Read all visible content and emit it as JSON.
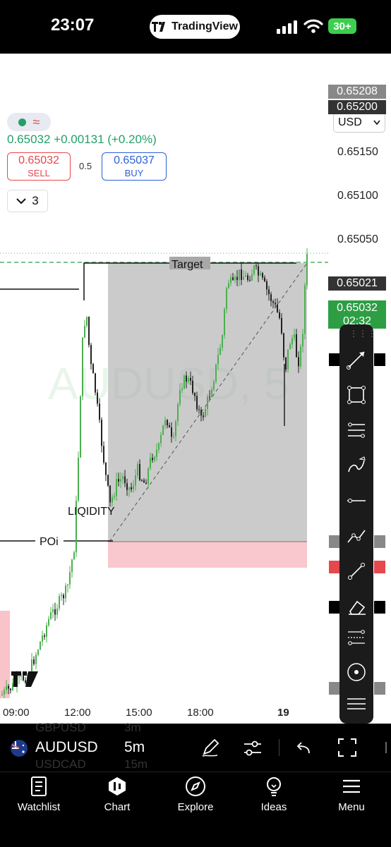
{
  "status_bar": {
    "time": "23:07",
    "app_pill": "TradingView",
    "battery": "30+"
  },
  "header": {
    "price_line": "0.65032 +0.00131 (+0.20%)",
    "sell": {
      "price": "0.65032",
      "label": "SELL"
    },
    "buy": {
      "price": "0.65037",
      "label": "BUY"
    },
    "spread": "0.5",
    "indicator_count": "3",
    "currency": "USD"
  },
  "chart": {
    "watermark": "AUDUSD, 5",
    "annotations": {
      "target": "Target",
      "liquidity": "LIQIDITY",
      "poi": "POi"
    },
    "price_labels": [
      "0.65150",
      "0.65100",
      "0.65050"
    ],
    "price_tags": {
      "top1": "0.65208",
      "top2": "0.65200",
      "current": "0.65032",
      "countdown": "02:32",
      "entry": "0.65021"
    },
    "time_labels": [
      "09:00",
      "12:00",
      "15:00",
      "18:00",
      "19"
    ],
    "bull_color": "#4caf50",
    "bear_color": "#222222"
  },
  "symbol_bar": {
    "symbol": "AUDUSD",
    "interval": "5m",
    "behind_symbols": [
      "GBPUSD",
      "USDCAD"
    ],
    "behind_intervals": [
      "3m",
      "15m"
    ]
  },
  "toolbar_icons": [
    "trend-line-icon",
    "rectangle-icon",
    "fib-retracement-icon",
    "brush-icon",
    "horizontal-line-icon",
    "path-icon",
    "ray-icon",
    "eraser-icon",
    "gann-icon",
    "circle-target-icon",
    "parallel-channel-icon"
  ],
  "nav": [
    {
      "label": "Watchlist",
      "icon": "watchlist-icon"
    },
    {
      "label": "Chart",
      "icon": "chart-icon"
    },
    {
      "label": "Explore",
      "icon": "compass-icon"
    },
    {
      "label": "Ideas",
      "icon": "lightbulb-icon"
    },
    {
      "label": "Menu",
      "icon": "hamburger-icon"
    }
  ]
}
